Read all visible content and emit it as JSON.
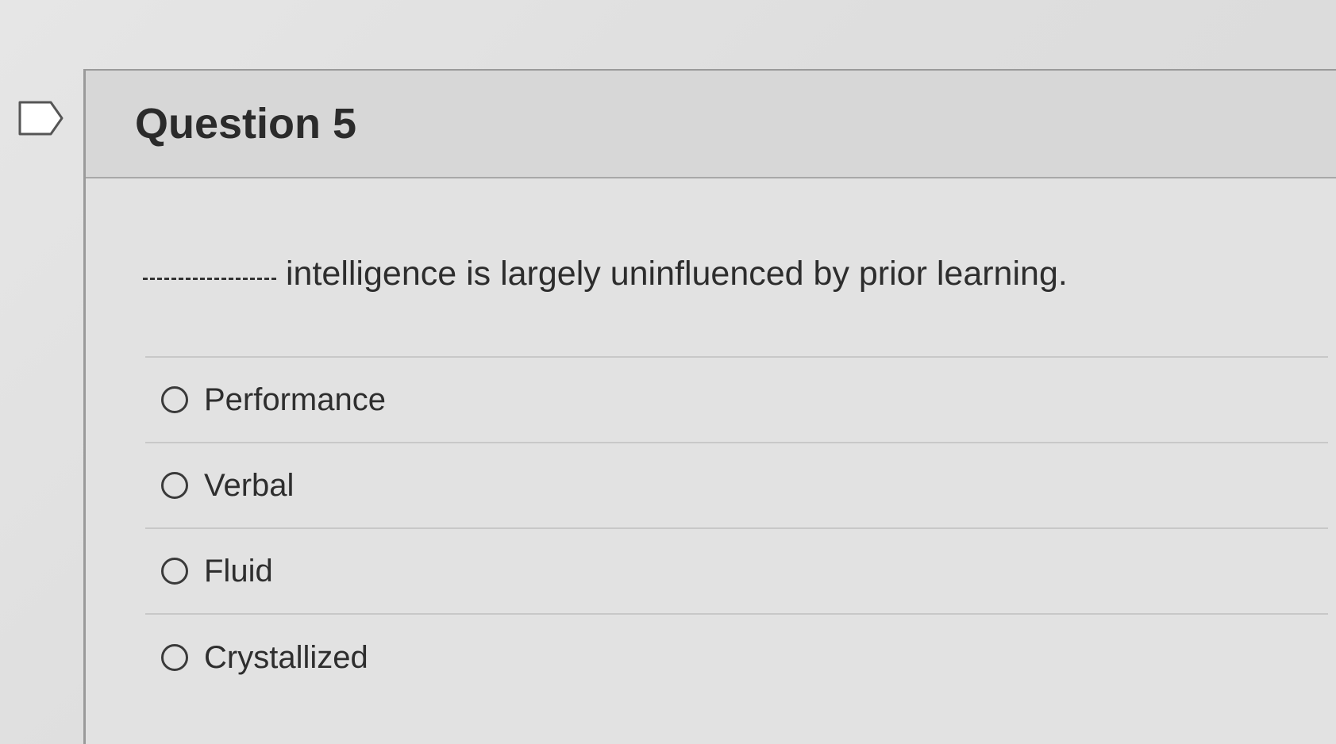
{
  "question": {
    "title": "Question 5",
    "text": "intelligence is largely uninfluenced by prior learning.",
    "answers": [
      {
        "label": "Performance",
        "selected": false
      },
      {
        "label": "Verbal",
        "selected": false
      },
      {
        "label": "Fluid",
        "selected": false
      },
      {
        "label": "Crystallized",
        "selected": false
      }
    ]
  },
  "icons": {
    "flag": "flag-question-icon"
  },
  "colors": {
    "header_bg": "#d7d7d7",
    "card_bg": "#e2e2e2",
    "text": "#2d2d2d"
  }
}
